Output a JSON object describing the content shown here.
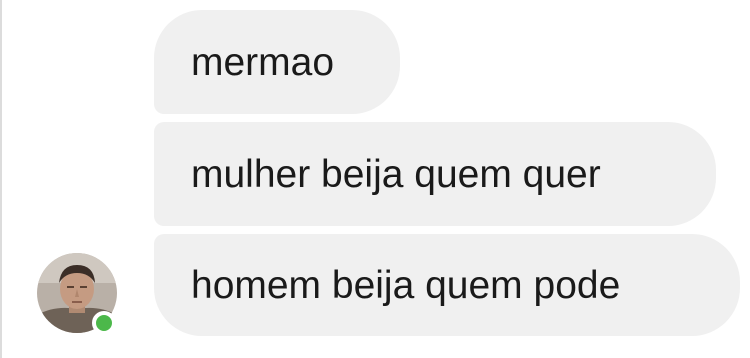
{
  "messages": [
    {
      "text": "mermao"
    },
    {
      "text": "mulher beija quem quer"
    },
    {
      "text": "homem beija quem pode"
    }
  ],
  "sender": {
    "avatar_icon": "user-photo",
    "online_status": "online",
    "online_color": "#4cb84a"
  },
  "colors": {
    "bubble_background": "#f0f0f0",
    "text": "#1a1a1a",
    "background": "#ffffff"
  }
}
